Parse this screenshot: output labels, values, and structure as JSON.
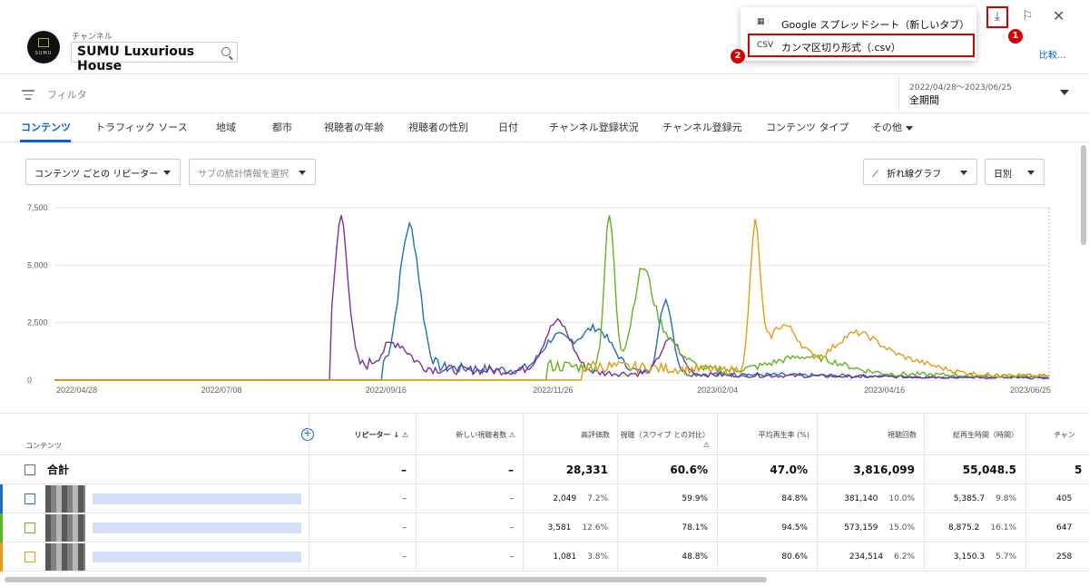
{
  "channel": {
    "label": "チャンネル",
    "name": "SUMU Luxurious House",
    "logo_text": "SUMU"
  },
  "export_menu": {
    "items": [
      {
        "icon": "sheets-icon",
        "label": "Google スプレッドシート（新しいタブ）"
      },
      {
        "icon": "csv-icon",
        "icon_text": "CSV",
        "label": "カンマ区切り形式（.csv）"
      }
    ]
  },
  "annotations": {
    "badge1": "1",
    "badge2": "2"
  },
  "compare_link": "比較...",
  "filter": {
    "placeholder": "フィルタ"
  },
  "date_range": {
    "range": "2022/04/28～2023/06/25",
    "label": "全期間"
  },
  "tabs": [
    "コンテンツ",
    "トラフィック ソース",
    "地域",
    "都市",
    "視聴者の年齢",
    "視聴者の性別",
    "日付",
    "チャンネル登録状況",
    "チャンネル登録元",
    "コンテンツ タイプ",
    "その他"
  ],
  "controls": {
    "metric": "コンテンツ ごとの リピーター",
    "secondary": "サブの統計情報を選択",
    "chart_type": "折れ線グラフ",
    "interval": "日別"
  },
  "chart_data": {
    "type": "line",
    "x": [
      "2022/04/28",
      "2022/07/08",
      "2022/09/16",
      "2022/11/26",
      "2023/02/04",
      "2023/04/16",
      "2023/06/25"
    ],
    "yticks": [
      "7,500",
      "5,000",
      "2,500",
      "0"
    ],
    "ylim": [
      0,
      7500
    ],
    "grid": true,
    "series": [
      {
        "color": "#1f6fb5",
        "peak": 6100,
        "peak_at": "2022/09/26"
      },
      {
        "color": "#7b2fa0",
        "peak": 6500,
        "peak_at": "2022/08/28"
      },
      {
        "color": "#5fb320",
        "peak": 6450,
        "peak_at": "2022/12/20"
      },
      {
        "color": "#e39a14",
        "peak": 6000,
        "peak_at": "2023/02/20"
      }
    ]
  },
  "table": {
    "headers": [
      "コンテンツ",
      "リピーター ↓ ⚠",
      "新しい視聴者数 ⚠",
      "高評価数",
      "視聴（スワイプ との対比）⚠",
      "平均再生率 (%)",
      "視聴回数",
      "総再生時間（時間）",
      "チャン"
    ],
    "total": {
      "label": "合計",
      "repeaters": "–",
      "new_viewers": "–",
      "likes": "28,331",
      "viewed_vs_swiped": "60.6%",
      "avg_pct": "47.0%",
      "views": "3,816,099",
      "watch_time": "55,048.5",
      "subs": "5"
    },
    "rows": [
      {
        "color": "#1f6fb5",
        "repeaters": "–",
        "new_viewers": "–",
        "likes": "2,049",
        "likes_pct": "7.2%",
        "viewed_vs_swiped": "59.9%",
        "avg_pct": "84.8%",
        "views": "381,140",
        "views_pct": "10.0%",
        "watch_time": "5,385.7",
        "watch_pct": "9.8%",
        "subs": "405"
      },
      {
        "color": "#5fb320",
        "repeaters": "–",
        "new_viewers": "–",
        "likes": "3,581",
        "likes_pct": "12.6%",
        "viewed_vs_swiped": "78.1%",
        "avg_pct": "94.5%",
        "views": "573,159",
        "views_pct": "15.0%",
        "watch_time": "8,875.2",
        "watch_pct": "16.1%",
        "subs": "647"
      },
      {
        "color": "#e39a14",
        "repeaters": "–",
        "new_viewers": "–",
        "likes": "1,081",
        "likes_pct": "3.8%",
        "viewed_vs_swiped": "48.8%",
        "avg_pct": "80.6%",
        "views": "234,514",
        "views_pct": "6.2%",
        "watch_time": "3,150.3",
        "watch_pct": "5.7%",
        "subs": "258"
      }
    ]
  }
}
